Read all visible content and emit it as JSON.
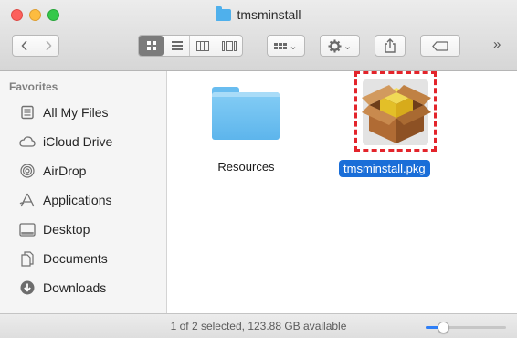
{
  "window": {
    "title": "tmsminstall",
    "title_icon": "folder-icon"
  },
  "toolbar": {
    "more": "»",
    "view_chevron": "⌄",
    "action_chevron": "⌄"
  },
  "sidebar": {
    "heading": "Favorites",
    "items": [
      {
        "label": "All My Files",
        "icon": "all-files-icon"
      },
      {
        "label": "iCloud Drive",
        "icon": "cloud-icon"
      },
      {
        "label": "AirDrop",
        "icon": "airdrop-icon"
      },
      {
        "label": "Applications",
        "icon": "applications-icon"
      },
      {
        "label": "Desktop",
        "icon": "desktop-icon"
      },
      {
        "label": "Documents",
        "icon": "documents-icon"
      },
      {
        "label": "Downloads",
        "icon": "downloads-icon"
      }
    ]
  },
  "files": [
    {
      "name": "Resources",
      "type": "folder",
      "selected": false
    },
    {
      "name": "tmsminstall.pkg",
      "type": "package",
      "selected": true
    }
  ],
  "status": {
    "text": "1 of 2 selected, 123.88 GB available",
    "icon_size_level": 0.22
  },
  "colors": {
    "selection": "#1a6ed8",
    "highlight_box": "#e3242b",
    "folder": "#5db5ec"
  }
}
